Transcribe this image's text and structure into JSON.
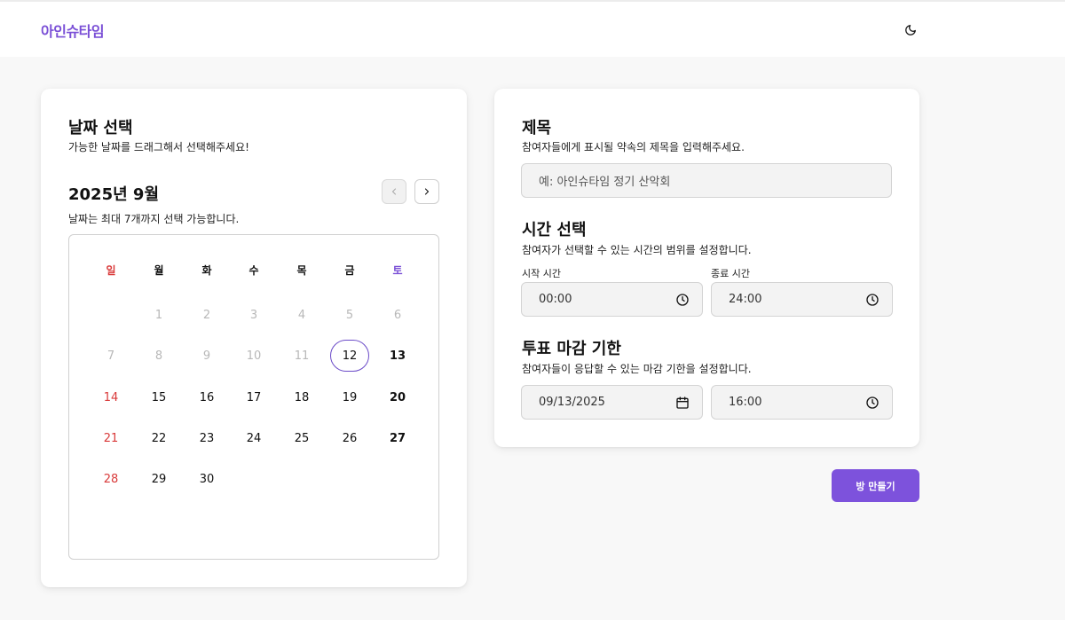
{
  "app": {
    "logo": "아인슈타임"
  },
  "header": {
    "theme_icon": "moon-icon"
  },
  "date_panel": {
    "title": "날짜 선택",
    "subtitle": "가능한 날짜를 드래그해서 선택해주세요!",
    "month_label": "2025년 9월",
    "limit_note": "날짜는 최대 7개까지 선택 가능합니다.",
    "weekdays": [
      "일",
      "월",
      "화",
      "수",
      "목",
      "금",
      "토"
    ],
    "weeks": [
      [
        "",
        "1",
        "2",
        "3",
        "4",
        "5",
        "6"
      ],
      [
        "7",
        "8",
        "9",
        "10",
        "11",
        "12",
        "13"
      ],
      [
        "14",
        "15",
        "16",
        "17",
        "18",
        "19",
        "20"
      ],
      [
        "21",
        "22",
        "23",
        "24",
        "25",
        "26",
        "27"
      ],
      [
        "28",
        "29",
        "30",
        "",
        "",
        "",
        ""
      ]
    ],
    "today": "12",
    "colors": {
      "sunday": "#d93a3a",
      "saturday_header": "#7a4fd6",
      "today_ring": "#6b4bc8"
    }
  },
  "form": {
    "title_section": {
      "heading": "제목",
      "desc": "참여자들에게 표시될 약속의 제목을 입력해주세요.",
      "placeholder": "예: 아인슈타임 정기 산악회"
    },
    "time_section": {
      "heading": "시간 선택",
      "desc": "참여자가 선택할 수 있는 시간의 범위를 설정합니다.",
      "start_label": "시작 시간",
      "start_value": "00:00",
      "end_label": "종료 시간",
      "end_value": "24:00"
    },
    "deadline_section": {
      "heading": "투표 마감 기한",
      "desc": "참여자들이 응답할 수 있는 마감 기한을 설정합니다.",
      "date_value": "09/13/2025",
      "time_value": "16:00"
    }
  },
  "actions": {
    "create_label": "방 만들기",
    "accent": "#7d52dc"
  }
}
